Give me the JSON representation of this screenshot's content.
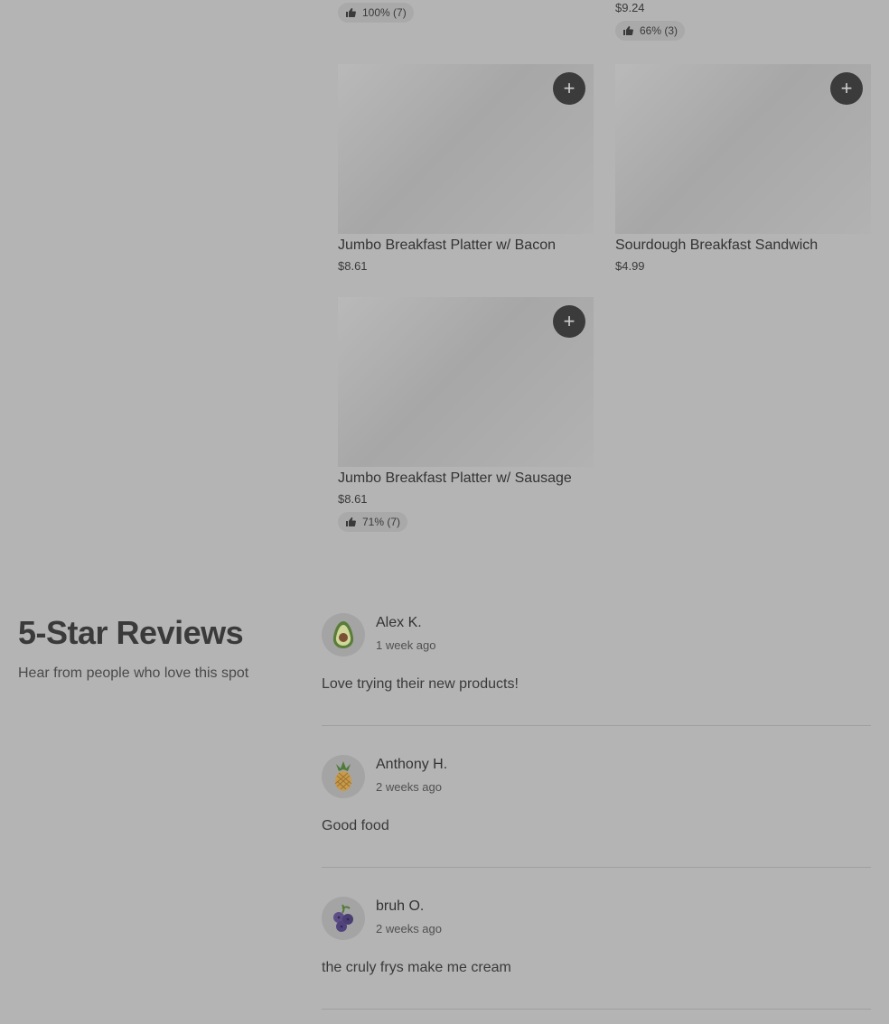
{
  "menu_items": [
    {
      "name": "",
      "price": "",
      "rating": "100% (7)"
    },
    {
      "name": "",
      "price": "$9.24",
      "rating": "66% (3)"
    },
    {
      "name": "Jumbo Breakfast Platter w/ Bacon",
      "price": "$8.61",
      "rating": ""
    },
    {
      "name": "Sourdough Breakfast Sandwich",
      "price": "$4.99",
      "rating": ""
    },
    {
      "name": "Jumbo Breakfast Platter w/ Sausage",
      "price": "$8.61",
      "rating": "71% (7)"
    }
  ],
  "add_button_label": "+",
  "reviews_section": {
    "title": "5-Star Reviews",
    "subtitle": "Hear from people who love this spot"
  },
  "reviews": [
    {
      "name": "Alex K.",
      "time": "1 week ago",
      "text": "Love trying their new products!",
      "avatar_icon": "avocado-icon"
    },
    {
      "name": "Anthony H.",
      "time": "2 weeks ago",
      "text": "Good food",
      "avatar_icon": "pineapple-icon"
    },
    {
      "name": "bruh O.",
      "time": "2 weeks ago",
      "text": "the cruly frys make me cream",
      "avatar_icon": "blueberries-icon"
    }
  ]
}
